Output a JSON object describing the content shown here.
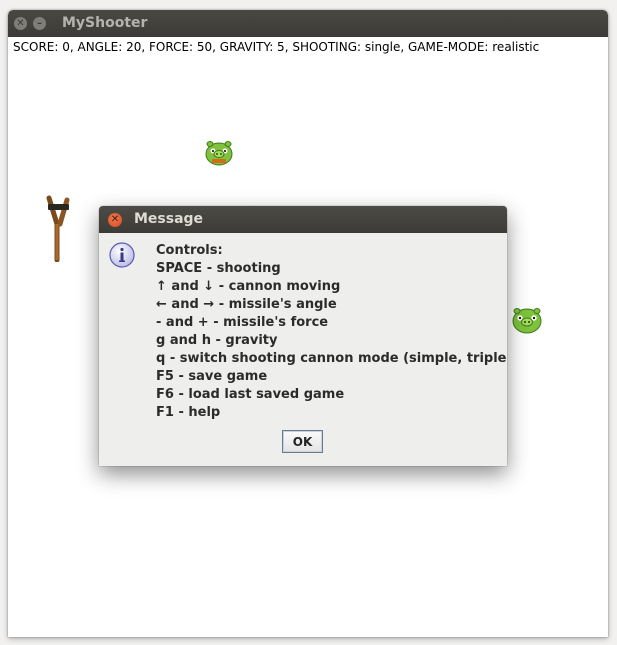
{
  "window": {
    "title": "MyShooter",
    "controls": [
      "close-icon",
      "minimize-icon"
    ]
  },
  "status": {
    "text": "SCORE: 0, ANGLE: 20, FORCE: 50, GRAVITY: 5, SHOOTING: single, GAME-MODE: realistic"
  },
  "scene": {
    "sprites": [
      "slingshot-icon",
      "green-pig-icon",
      "green-pig-icon"
    ]
  },
  "dialog": {
    "title": "Message",
    "icon": "info-icon",
    "lines": [
      "Controls:",
      "SPACE - shooting",
      "↑ and ↓ - cannon moving",
      "← and → - missile's angle",
      "- and + - missile's force",
      "g and h - gravity",
      "q - switch shooting cannon mode (simple, triple)",
      "F5 - save game",
      "F6 - load last saved game",
      "F1 - help"
    ],
    "ok_label": "OK"
  },
  "colors": {
    "titlebar": "#3c3b37",
    "close_button": "#df4a16",
    "pig_green": "#7ec23d"
  }
}
